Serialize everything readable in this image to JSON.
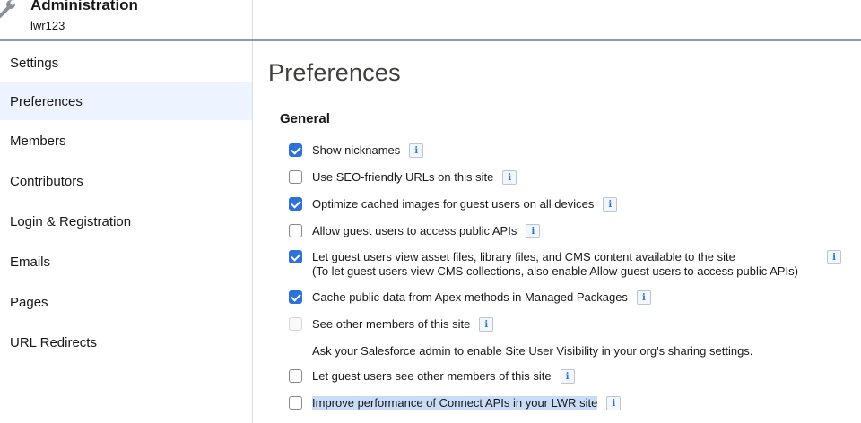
{
  "header": {
    "title": "Administration",
    "subtitle": "lwr123",
    "icon": "wrench-icon"
  },
  "sidebar": {
    "items": [
      {
        "label": "Settings",
        "active": false
      },
      {
        "label": "Preferences",
        "active": true
      },
      {
        "label": "Members",
        "active": false
      },
      {
        "label": "Contributors",
        "active": false
      },
      {
        "label": "Login & Registration",
        "active": false
      },
      {
        "label": "Emails",
        "active": false
      },
      {
        "label": "Pages",
        "active": false
      },
      {
        "label": "URL Redirects",
        "active": false
      }
    ]
  },
  "main": {
    "title": "Preferences",
    "section": "General",
    "info_glyph": "i",
    "options": [
      {
        "label": "Show nicknames",
        "checked": true
      },
      {
        "label": "Use SEO-friendly URLs on this site",
        "checked": false
      },
      {
        "label": "Optimize cached images for guest users on all devices",
        "checked": true
      },
      {
        "label": "Allow guest users to access public APIs",
        "checked": false
      },
      {
        "label": "Let guest users view asset files, library files, and CMS content available to the site",
        "label2": "(To let guest users view CMS collections, also enable Allow guest users to access public APIs)",
        "checked": true
      },
      {
        "label": "Cache public data from Apex methods in Managed Packages",
        "checked": true
      },
      {
        "label": "See other members of this site",
        "checked": false,
        "disabled": true
      },
      {
        "label": "Let guest users see other members of this site",
        "checked": false
      },
      {
        "label": "Improve performance of Connect APIs in your LWR site",
        "checked": false,
        "highlighted": true
      }
    ],
    "note": "Ask your Salesforce admin to enable Site User Visibility in your org's sharing settings."
  },
  "colors": {
    "accent": "#2d72d9",
    "active_bg": "#eef4ff",
    "header_line": "#8a9bb0"
  }
}
